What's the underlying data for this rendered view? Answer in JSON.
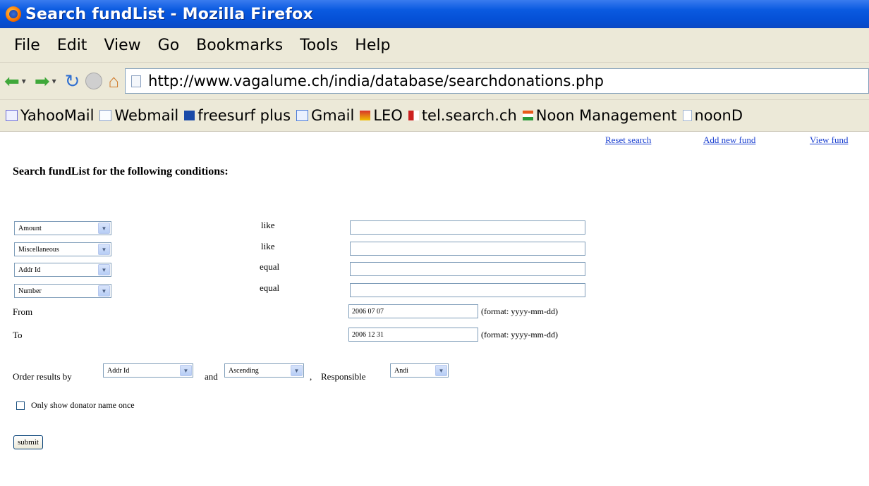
{
  "window": {
    "title": "Search fundList - Mozilla Firefox"
  },
  "menubar": {
    "items": [
      "File",
      "Edit",
      "View",
      "Go",
      "Bookmarks",
      "Tools",
      "Help"
    ]
  },
  "navigation": {
    "url": "http://www.vagalume.ch/india/database/searchdonations.php"
  },
  "bookmarks": [
    {
      "label": "YahooMail",
      "icon": "yahoo-mail-icon",
      "color": "#6b6bd6"
    },
    {
      "label": "Webmail",
      "icon": "envelope-icon",
      "color": "#8aa0c8"
    },
    {
      "label": "freesurf plus",
      "icon": "freesurf-icon",
      "color": "#1a4aa8"
    },
    {
      "label": "Gmail",
      "icon": "gmail-icon",
      "color": "#4a7ad8"
    },
    {
      "label": "LEO",
      "icon": "leo-icon",
      "color": "#d8342a"
    },
    {
      "label": "tel.search.ch",
      "icon": "tel-search-icon",
      "color": "#cc2222"
    },
    {
      "label": "Noon Management",
      "icon": "flag-icon",
      "color": "#e85a1a"
    },
    {
      "label": "noonD",
      "icon": "page-icon",
      "color": "#a0b4d0"
    }
  ],
  "links": {
    "reset": "Reset search",
    "add": "Add new fund",
    "view": "View fund"
  },
  "form": {
    "heading": "Search fundList for the following conditions:",
    "conditions": [
      {
        "field": "Amount",
        "operator": "like",
        "value": ""
      },
      {
        "field": "Miscellaneous",
        "operator": "like",
        "value": ""
      },
      {
        "field": "Addr Id",
        "operator": "equal",
        "value": ""
      },
      {
        "field": "Number",
        "operator": "equal",
        "value": ""
      }
    ],
    "from": {
      "label": "From",
      "value": "2006 07 07",
      "hint": "(format: yyyy-mm-dd)"
    },
    "to": {
      "label": "To",
      "value": "2006 12 31",
      "hint": "(format: yyyy-mm-dd)"
    },
    "order": {
      "label": "Order results by",
      "field": "Addr Id",
      "and_label": "and",
      "direction": "Ascending",
      "separator": ",",
      "responsible_label": "Responsible",
      "responsible": "Andi"
    },
    "only_once_label": "Only show donator name once",
    "submit_label": "submit"
  }
}
